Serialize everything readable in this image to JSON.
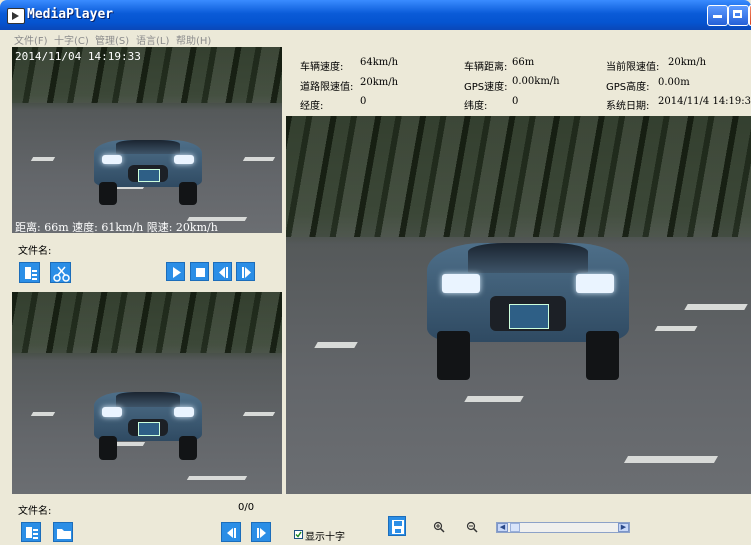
{
  "window": {
    "title": "MediaPlayer"
  },
  "menu": [
    "文件(F)",
    "十字(C)",
    "管理(S)",
    "语言(L)",
    "帮助(H)"
  ],
  "top_left_panel": {
    "timestamp": "2014/11/04 14:19:33",
    "overlay_info": "距离: 66m 速度: 61km/h 限速: 20km/h"
  },
  "top_left_controls": {
    "filename_label": "文件名:"
  },
  "bottom_left_controls": {
    "filename_label": "文件名:",
    "frame_counter": "0/0"
  },
  "info": {
    "vehicle_speed_label": "车辆速度:",
    "vehicle_speed": "64km/h",
    "vehicle_distance_label": "车辆距离:",
    "vehicle_distance": "66m",
    "current_limit_label": "当前限速值:",
    "current_limit": "20km/h",
    "road_limit_label": "道路限速值:",
    "road_limit": "20km/h",
    "gps_speed_label": "GPS速度:",
    "gps_speed": "0.00km/h",
    "gps_altitude_label": "GPS高度:",
    "gps_altitude": "0.00m",
    "longitude_label": "经度:",
    "longitude": "0",
    "latitude_label": "纬度:",
    "latitude": "0",
    "system_date_label": "系统日期:",
    "system_date": "2014/11/4 14:19:3"
  },
  "bottom_bar": {
    "show_crosshair_label": "显示十字",
    "show_crosshair_checked": true
  },
  "colors": {
    "titlebar": "#0554D0",
    "button_blue": "#2B8EE6",
    "chrome": "#ECE9D8"
  }
}
